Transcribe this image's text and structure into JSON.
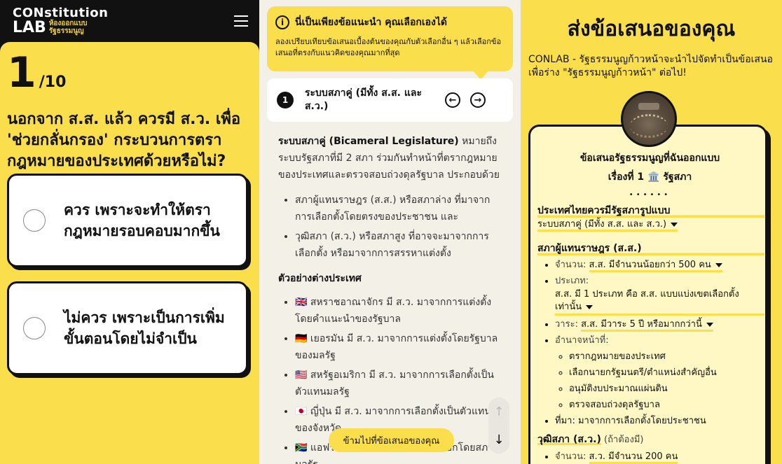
{
  "app": {
    "logo_line1": "CONstitution",
    "logo_lab": "LAB",
    "logo_sub1": "ห้องออกแบบ",
    "logo_sub2": "รัฐธรรมนูญ"
  },
  "question": {
    "current": "1",
    "total": "/10",
    "text": "นอกจาก ส.ส. แล้ว ควรมี ส.ว. เพื่อ 'ช่วยกลั่นกรอง' กระบวนการตรากฎหมายของประเทศด้วยหรือไม่?",
    "answers": [
      "ควร เพราะจะทำให้ตรากฎหมายรอบคอบมากขึ้น",
      "ไม่ควร เพราะเป็นการเพิ่มขั้นตอนโดยไม่จำเป็น"
    ]
  },
  "info": {
    "title": "นี่เป็นเพียงข้อแนะนำ คุณเลือกเองได้",
    "description": "ลองเปรียบเทียบข้อเสนอเบื้องต้นของคุณกับตัวเลือกอื่น ๆ แล้วเลือกข้อเสนอที่ตรงกับแนวคิดของคุณมากที่สุด"
  },
  "topic": {
    "number": "1",
    "title": "ระบบสภาคู่ (มีทั้ง ส.ส. และ ส.ว.)"
  },
  "content": {
    "intro_bold": "ระบบสภาคู่ (Bicameral Legislature)",
    "intro_rest": " หมายถึง ระบบรัฐสภาที่มี 2 สภา ร่วมกันทำหน้าที่ตรากฎหมายของประเทศและตรวจสอบถ่วงดุลรัฐบาล ประกอบด้วย",
    "bullets": [
      "สภาผู้แทนราษฎร (ส.ส.) หรือสภาล่าง ที่มาจากการเลือกตั้งโดยตรงของประชาชน และ",
      "วุฒิสภา (ส.ว.) หรือสภาสูง ที่อาจจะมาจากการเลือกตั้ง หรือมาจากการสรรหาแต่งตั้ง"
    ],
    "examples_heading": "ตัวอย่างต่างประเทศ",
    "examples": [
      "🇬🇧 สหราชอาณาจักร มี ส.ว. มาจากการแต่งตั้งโดยคำแนะนำของรัฐบาล",
      "🇩🇪 เยอรมัน มี ส.ว. มาจากการแต่งตั้งโดยรัฐบาลของมลรัฐ",
      "🇺🇸 สหรัฐอเมริกา มี ส.ว. มาจากการเลือกตั้งเป็นตัวแทนมลรัฐ",
      "🇯🇵 ญี่ปุ่น มี ส.ว. มาจากการเลือกตั้งเป็นตัวแทนของจังหวัด",
      "🇿🇦 แอฟริกาใต้ มี ส.ว. มาจากการเลือกโดยสภามลรัฐ"
    ]
  },
  "skip_button": "ข้ามไปที่ข้อเสนอของคุณ",
  "proposal": {
    "title": "ส่งข้อเสนอของคุณ",
    "intro": "CONLAB - รัฐธรรมนูญก้าวหน้าจะนำไปจัดทำเป็นข้อเสนอเพื่อร่าง \"รัฐธรรมนูญก้าวหน้า\" ต่อไป!",
    "card_heading": "ข้อเสนอรัฐธรรมนูญที่ฉันออกแบบ",
    "card_subheading": "เรื่องที่ 1 🏛️ รัฐสภา",
    "dots": "••••••",
    "q1_label": "ประเทศไทยควรมีรัฐสภารูปแบบ",
    "q1_value": "ระบบสภาคู่ (มีทั้ง ส.ส. และ ส.ว.)",
    "mp_heading": "สภาผู้แทนราษฎร (ส.ส.)",
    "mp_count_label": "จำนวน: ",
    "mp_count_value": "ส.ส. มีจำนวนน้อยกว่า 500 คน",
    "mp_type_label": "ประเภท:",
    "mp_type_value": "ส.ส. มี 1 ประเภท คือ ส.ส. แบบแบ่งเขตเลือกตั้ง เท่านั้น",
    "mp_term_label": "วาระ: ",
    "mp_term_value": "ส.ส. มีวาระ 5 ปี หรือมากกว่านี้",
    "mp_duty_label": "อำนาจหน้าที่:",
    "mp_duties": [
      "ตรากฎหมายของประเทศ",
      "เลือกนายกรัฐมนตรี/ตำแหน่งสำคัญอื่น",
      "อนุมัติงบประมาณแผ่นดิน",
      "ตรวจสอบถ่วงดุลรัฐบาล"
    ],
    "mp_source": "ที่มา: มาจากการเลือกตั้งโดยประชาชน",
    "senate_heading": "วุฒิสภา (ส.ว.)",
    "senate_optional": " (ถ้าต้องมี)",
    "senate_count_label": "จำนวน: ",
    "senate_count_value": "ส.ว. มีจำนวน 200 คน"
  },
  "colors": {
    "accent_yellow": "#fbde4b",
    "dark": "#111111",
    "middle_bg": "#f3f0e8",
    "card_bg": "#fff8c4"
  }
}
